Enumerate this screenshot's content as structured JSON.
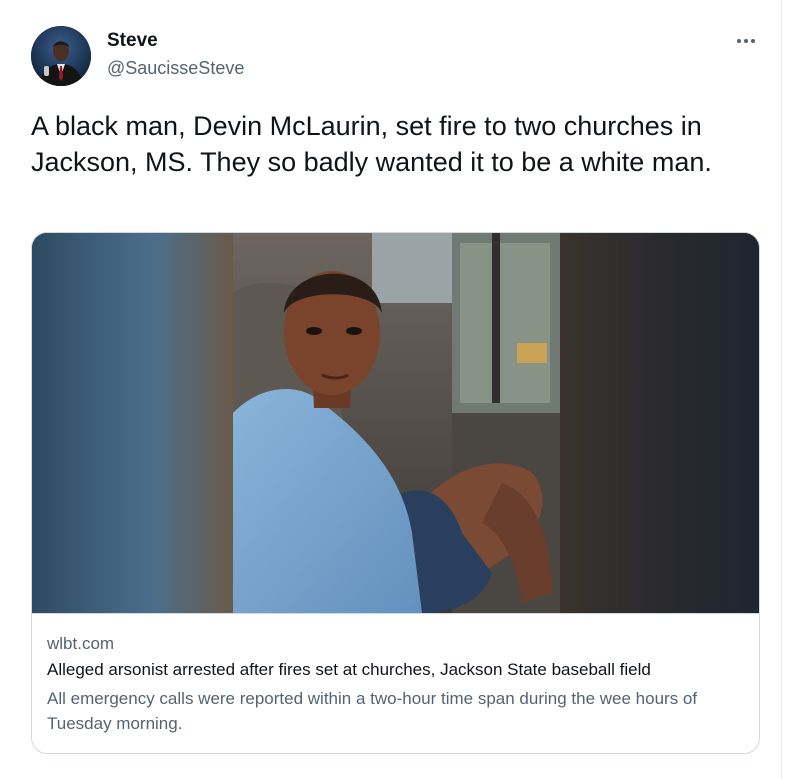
{
  "author": {
    "name": "Steve",
    "handle": "@SaucisseSteve"
  },
  "tweet": {
    "text": "A black man, Devin McLaurin, set fire to two churches in Jackson, MS. They so badly wanted it to be a white man."
  },
  "card": {
    "domain": "wlbt.com",
    "title": "Alleged arsonist arrested after fires set at churches, Jackson State baseball field",
    "description": "All emergency calls were reported within a two-hour time span during the wee hours of Tuesday morning."
  },
  "icons": {
    "more": "more-options-icon"
  },
  "colors": {
    "text_primary": "#0f1419",
    "text_secondary": "#536471",
    "border": "#cfd9de"
  }
}
